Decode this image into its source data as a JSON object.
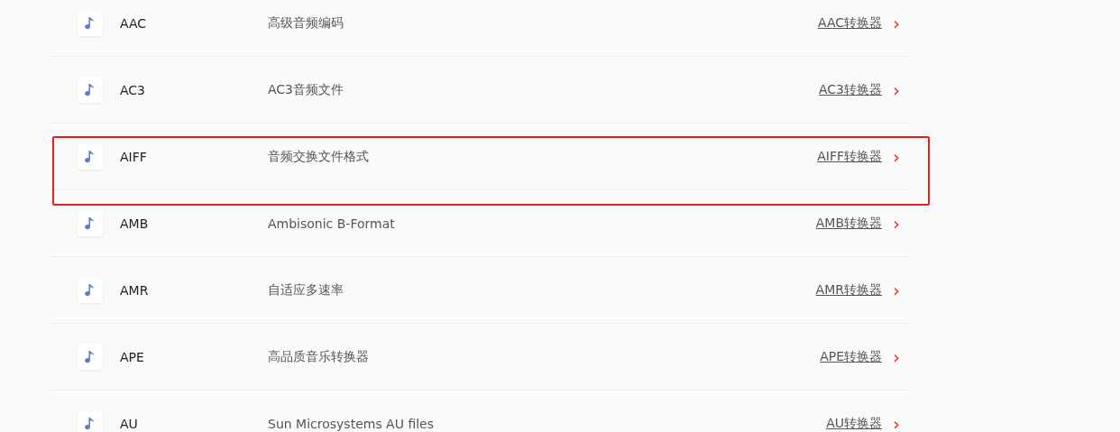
{
  "formats": [
    {
      "name": "AAC",
      "description": "高级音频编码",
      "link": "AAC转换器",
      "chevron": "›",
      "highlighted": false
    },
    {
      "name": "AC3",
      "description": "AC3音频文件",
      "link": "AC3转换器",
      "chevron": "›",
      "highlighted": false
    },
    {
      "name": "AIFF",
      "description": "音频交换文件格式",
      "link": "AIFF转换器",
      "chevron": "›",
      "highlighted": true
    },
    {
      "name": "AMB",
      "description": "Ambisonic B-Format",
      "link": "AMB转换器",
      "chevron": "›",
      "highlighted": false
    },
    {
      "name": "AMR",
      "description": "自适应多速率",
      "link": "AMR转换器",
      "chevron": "›",
      "highlighted": false
    },
    {
      "name": "APE",
      "description": "高品质音乐转换器",
      "link": "APE转换器",
      "chevron": "›",
      "highlighted": false
    },
    {
      "name": "AU",
      "description": "Sun Microsystems AU files",
      "link": "AU转换器",
      "chevron": "›",
      "highlighted": false
    }
  ]
}
